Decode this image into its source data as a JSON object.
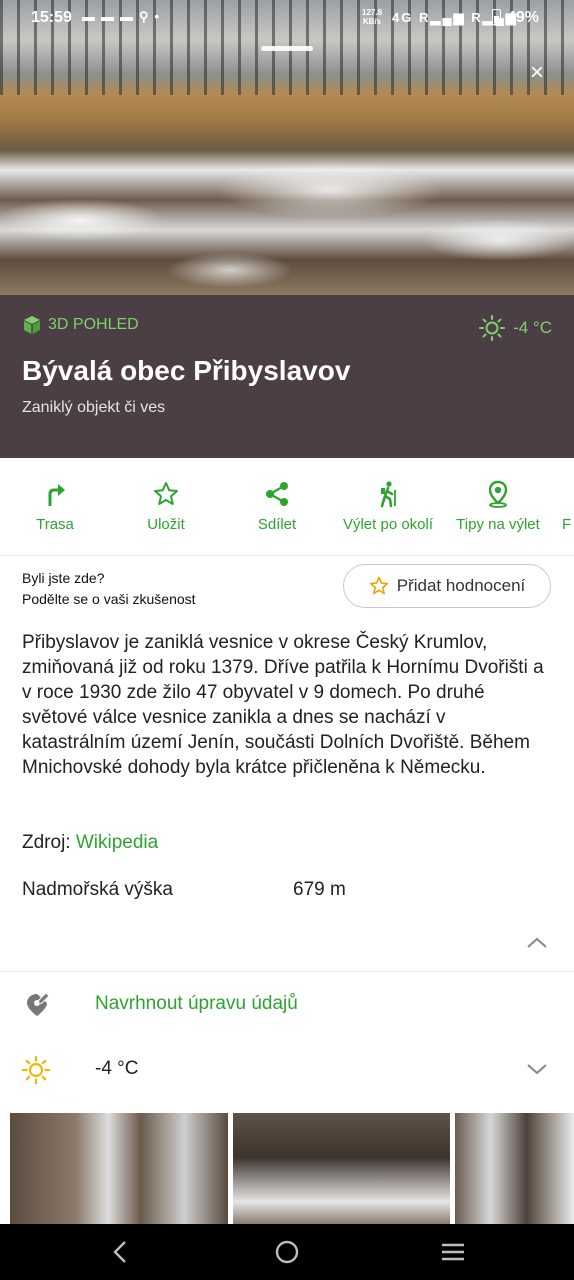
{
  "status_bar": {
    "time": "15:59",
    "net_speed": "127.8",
    "net_unit": "KB/s",
    "network": "4G",
    "roaming1": "R",
    "roaming2": "R",
    "battery": "49%"
  },
  "close_icon": "×",
  "header": {
    "badge": "3D POHLED",
    "weather": "-4 °C",
    "title": "Bývalá obec Přibyslavov",
    "subtitle": "Zaniklý objekt či ves"
  },
  "actions": [
    {
      "label": "Trasa",
      "icon": "route-icon"
    },
    {
      "label": "Uložit",
      "icon": "star-icon"
    },
    {
      "label": "Sdílet",
      "icon": "share-icon"
    },
    {
      "label": "Výlet po okolí",
      "icon": "hiker-icon"
    },
    {
      "label": "Tipy na výlet",
      "icon": "pin-icon"
    },
    {
      "label": "F",
      "icon": "partial-icon"
    }
  ],
  "rating": {
    "line1": "Byli jste zde?",
    "line2": "Podělte se o vaši zkušenost",
    "button": "Přidat hodnocení"
  },
  "description": "Přibyslavov je zaniklá vesnice v okrese Český Krumlov, zmiňovaná již od roku 1379. Dříve patřila k Hornímu Dvořišti a v roce 1930 zde žilo 47 obyvatel v 9 domech. Po druhé světové válce vesnice zanikla a dnes se nachází v katastrálním území Jenín, součásti Dolních Dvořiště. Během Mnichovské dohody byla krátce přičleněna k Německu.",
  "source": {
    "label": "Zdroj:",
    "link": "Wikipedia"
  },
  "elevation": {
    "label": "Nadmořská výška",
    "value": "679 m"
  },
  "suggest": "Navrhnout úpravu údajů",
  "weather_row": {
    "temp": "-4 °C"
  },
  "colors": {
    "accent": "#2fa32f",
    "panel": "#4b3f45",
    "badge": "#7fd06a"
  }
}
